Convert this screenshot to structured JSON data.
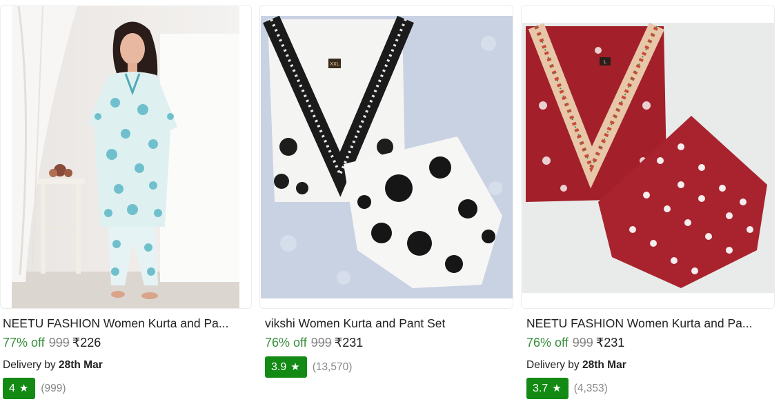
{
  "products": [
    {
      "title": "NEETU FASHION Women Kurta and Pa...",
      "discount": "77% off",
      "mrp": "999",
      "price": "₹226",
      "delivery_prefix": "Delivery by",
      "delivery_date": "28th Mar",
      "rating": "4",
      "rating_count": "(999)",
      "image_label": "woman-in-printed-kurta-set-photo"
    },
    {
      "title": "vikshi Women Kurta and Pant Set",
      "discount": "76% off",
      "mrp": "999",
      "price": "₹231",
      "rating": "3.9",
      "rating_count": "(13,570)",
      "tag": "XXL",
      "image_label": "black-white-floral-kurta-set-photo"
    },
    {
      "title": "NEETU FASHION Women Kurta and Pa...",
      "discount": "76% off",
      "mrp": "999",
      "price": "₹231",
      "delivery_prefix": "Delivery by",
      "delivery_date": "28th Mar",
      "rating": "3.7",
      "rating_count": "(4,353)",
      "tag": "L",
      "image_label": "maroon-printed-kurta-set-photo"
    }
  ],
  "icons": {
    "star": "star-icon"
  },
  "colors": {
    "discount": "#388e3c",
    "rating_badge": "#138a13",
    "muted": "#878787"
  }
}
